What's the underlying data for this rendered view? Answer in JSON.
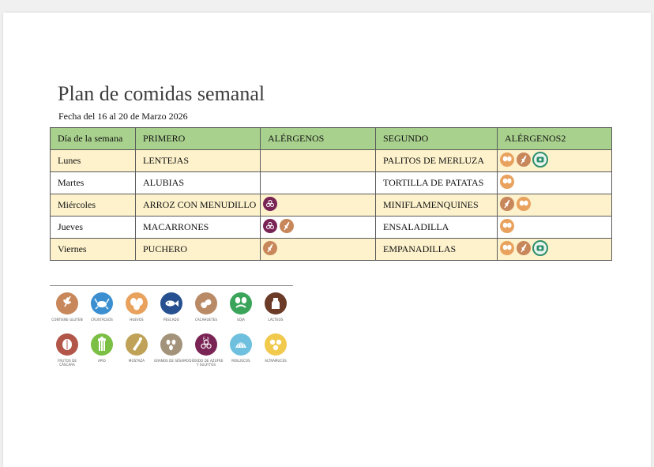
{
  "document": {
    "title": "Plan de comidas semanal",
    "date_line": "Fecha del 16 al 20 de Marzo 2026"
  },
  "table": {
    "headers": [
      "Día de la semana",
      "PRIMERO",
      "ALÉRGENOS",
      "SEGUNDO",
      "ALÉRGENOS2"
    ],
    "rows": [
      {
        "day": "Lunes",
        "primero": "LENTEJAS",
        "alergenos": [],
        "segundo": "PALITOS DE MERLUZA",
        "alergenos2": [
          "huevos",
          "gluten",
          "pescado"
        ]
      },
      {
        "day": "Martes",
        "primero": "ALUBIAS",
        "alergenos": [],
        "segundo": "TORTILLA DE PATATAS",
        "alergenos2": [
          "huevos"
        ]
      },
      {
        "day": "Miércoles",
        "primero": "ARROZ CON MENUDILLO",
        "alergenos": [
          "sulfitos"
        ],
        "segundo": "MINIFLAMENQUINES",
        "alergenos2": [
          "gluten",
          "huevos"
        ]
      },
      {
        "day": "Jueves",
        "primero": "MACARRONES",
        "alergenos": [
          "sulfitos",
          "gluten"
        ],
        "segundo": "ENSALADILLA",
        "alergenos2": [
          "huevos"
        ]
      },
      {
        "day": "Viernes",
        "primero": "PUCHERO",
        "alergenos": [
          "gluten"
        ],
        "segundo": "EMPANADILLAS",
        "alergenos2": [
          "huevos",
          "gluten",
          "pescado"
        ]
      }
    ]
  },
  "legend": {
    "items": [
      {
        "key": "gluten",
        "label": "CONTIENE GLUTEN",
        "color": "#c8875a"
      },
      {
        "key": "crustaceos",
        "label": "CRUSTÁCEOS",
        "color": "#3b8fd0"
      },
      {
        "key": "huevos",
        "label": "HUEVOS",
        "color": "#e9a25e"
      },
      {
        "key": "pescado",
        "label": "PESCADO",
        "color": "#26508f"
      },
      {
        "key": "cacahuetes",
        "label": "CACAHUETES",
        "color": "#b98a66"
      },
      {
        "key": "soja",
        "label": "SOJA",
        "color": "#3aa45a"
      },
      {
        "key": "lacteos",
        "label": "LÁCTEOS",
        "color": "#6b3b28"
      },
      {
        "key": "frutos",
        "label": "FRUTOS DE CÁSCARA",
        "color": "#b3564a"
      },
      {
        "key": "apio",
        "label": "APIO",
        "color": "#7bbf44"
      },
      {
        "key": "mostaza",
        "label": "MOSTAZA",
        "color": "#bfa257"
      },
      {
        "key": "sesamo",
        "label": "GRANOS DE SÉSAMO",
        "color": "#a2937a"
      },
      {
        "key": "sulfitos",
        "label": "DIÓXIDO DE AZUFRE Y SULFITOS",
        "color": "#7a2455"
      },
      {
        "key": "moluscos",
        "label": "MOLUSCOS",
        "color": "#6fc0de"
      },
      {
        "key": "altramuces",
        "label": "ALTRAMUCES",
        "color": "#f1c94c"
      }
    ],
    "sulfitos_mark": "E-X",
    "line_color": "#8a8a8a"
  },
  "icon_colors": {
    "gluten": "#c8875a",
    "huevos": "#e9a25e",
    "pescado": "#2f8f6c",
    "sulfitos": "#7a2455"
  },
  "colors": {
    "header_bg": "#a9d18e",
    "row_odd_bg": "#fdf2cc",
    "row_even_bg": "#ffffff"
  }
}
